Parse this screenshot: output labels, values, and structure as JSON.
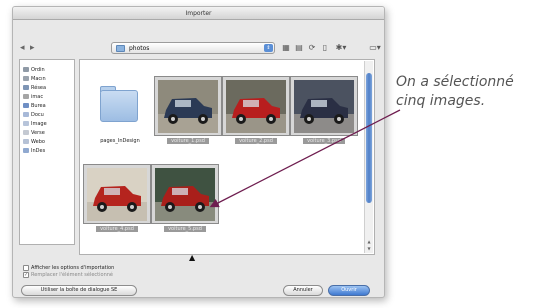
{
  "dialog": {
    "title": "Importer",
    "folder": {
      "name": "photos"
    },
    "sidebar": [
      {
        "label": "Ordin",
        "color": "#8f9aa6"
      },
      {
        "label": "Macın",
        "color": "#9aa3ad"
      },
      {
        "label": "Résea",
        "color": "#7e95b5"
      },
      {
        "label": "imac",
        "color": "#a5a5a5"
      },
      {
        "label": "Burea",
        "color": "#6f8fc4"
      },
      {
        "label": "Docu",
        "color": "#a7b9d8"
      },
      {
        "label": "Image",
        "color": "#b7c4da"
      },
      {
        "label": "Verse",
        "color": "#c4c9d2"
      },
      {
        "label": "Webo",
        "color": "#b6c2d6"
      },
      {
        "label": "InDes",
        "color": "#90a9d0"
      }
    ],
    "files": [
      {
        "name": "pages_InDesign",
        "kind": "folder",
        "selected": false
      },
      {
        "name": "voiture_1.psd",
        "kind": "photo",
        "selected": true,
        "car": "#2b3a55",
        "bg": "#8e8a7c"
      },
      {
        "name": "voiture_2.psd",
        "kind": "photo",
        "selected": true,
        "car": "#b81e1e",
        "bg": "#6b6a5e"
      },
      {
        "name": "voiture_3.psd",
        "kind": "photo",
        "selected": true,
        "car": "#2a2f44",
        "bg": "#4b5260"
      },
      {
        "name": "voiture_4.psd",
        "kind": "photo",
        "selected": true,
        "car": "#b5241e",
        "bg": "#d9d2c4"
      },
      {
        "name": "voiture_5.psd",
        "kind": "photo",
        "selected": true,
        "car": "#a91f1a",
        "bg": "#3f5241"
      }
    ],
    "options": {
      "show_import_options": "Afficher les options d'importation",
      "replace_selected": "Remplacer l'élément sélectionné"
    },
    "buttons": {
      "use_se": "Utiliser la boîte de dialogue SE",
      "cancel": "Annuler",
      "open": "Ouvrir"
    }
  },
  "annotation": {
    "line1": "On a sélectionné",
    "line2": "cinq images."
  },
  "colors": {
    "accent": "#4f7fc8",
    "arrow": "#6e1d4f"
  }
}
